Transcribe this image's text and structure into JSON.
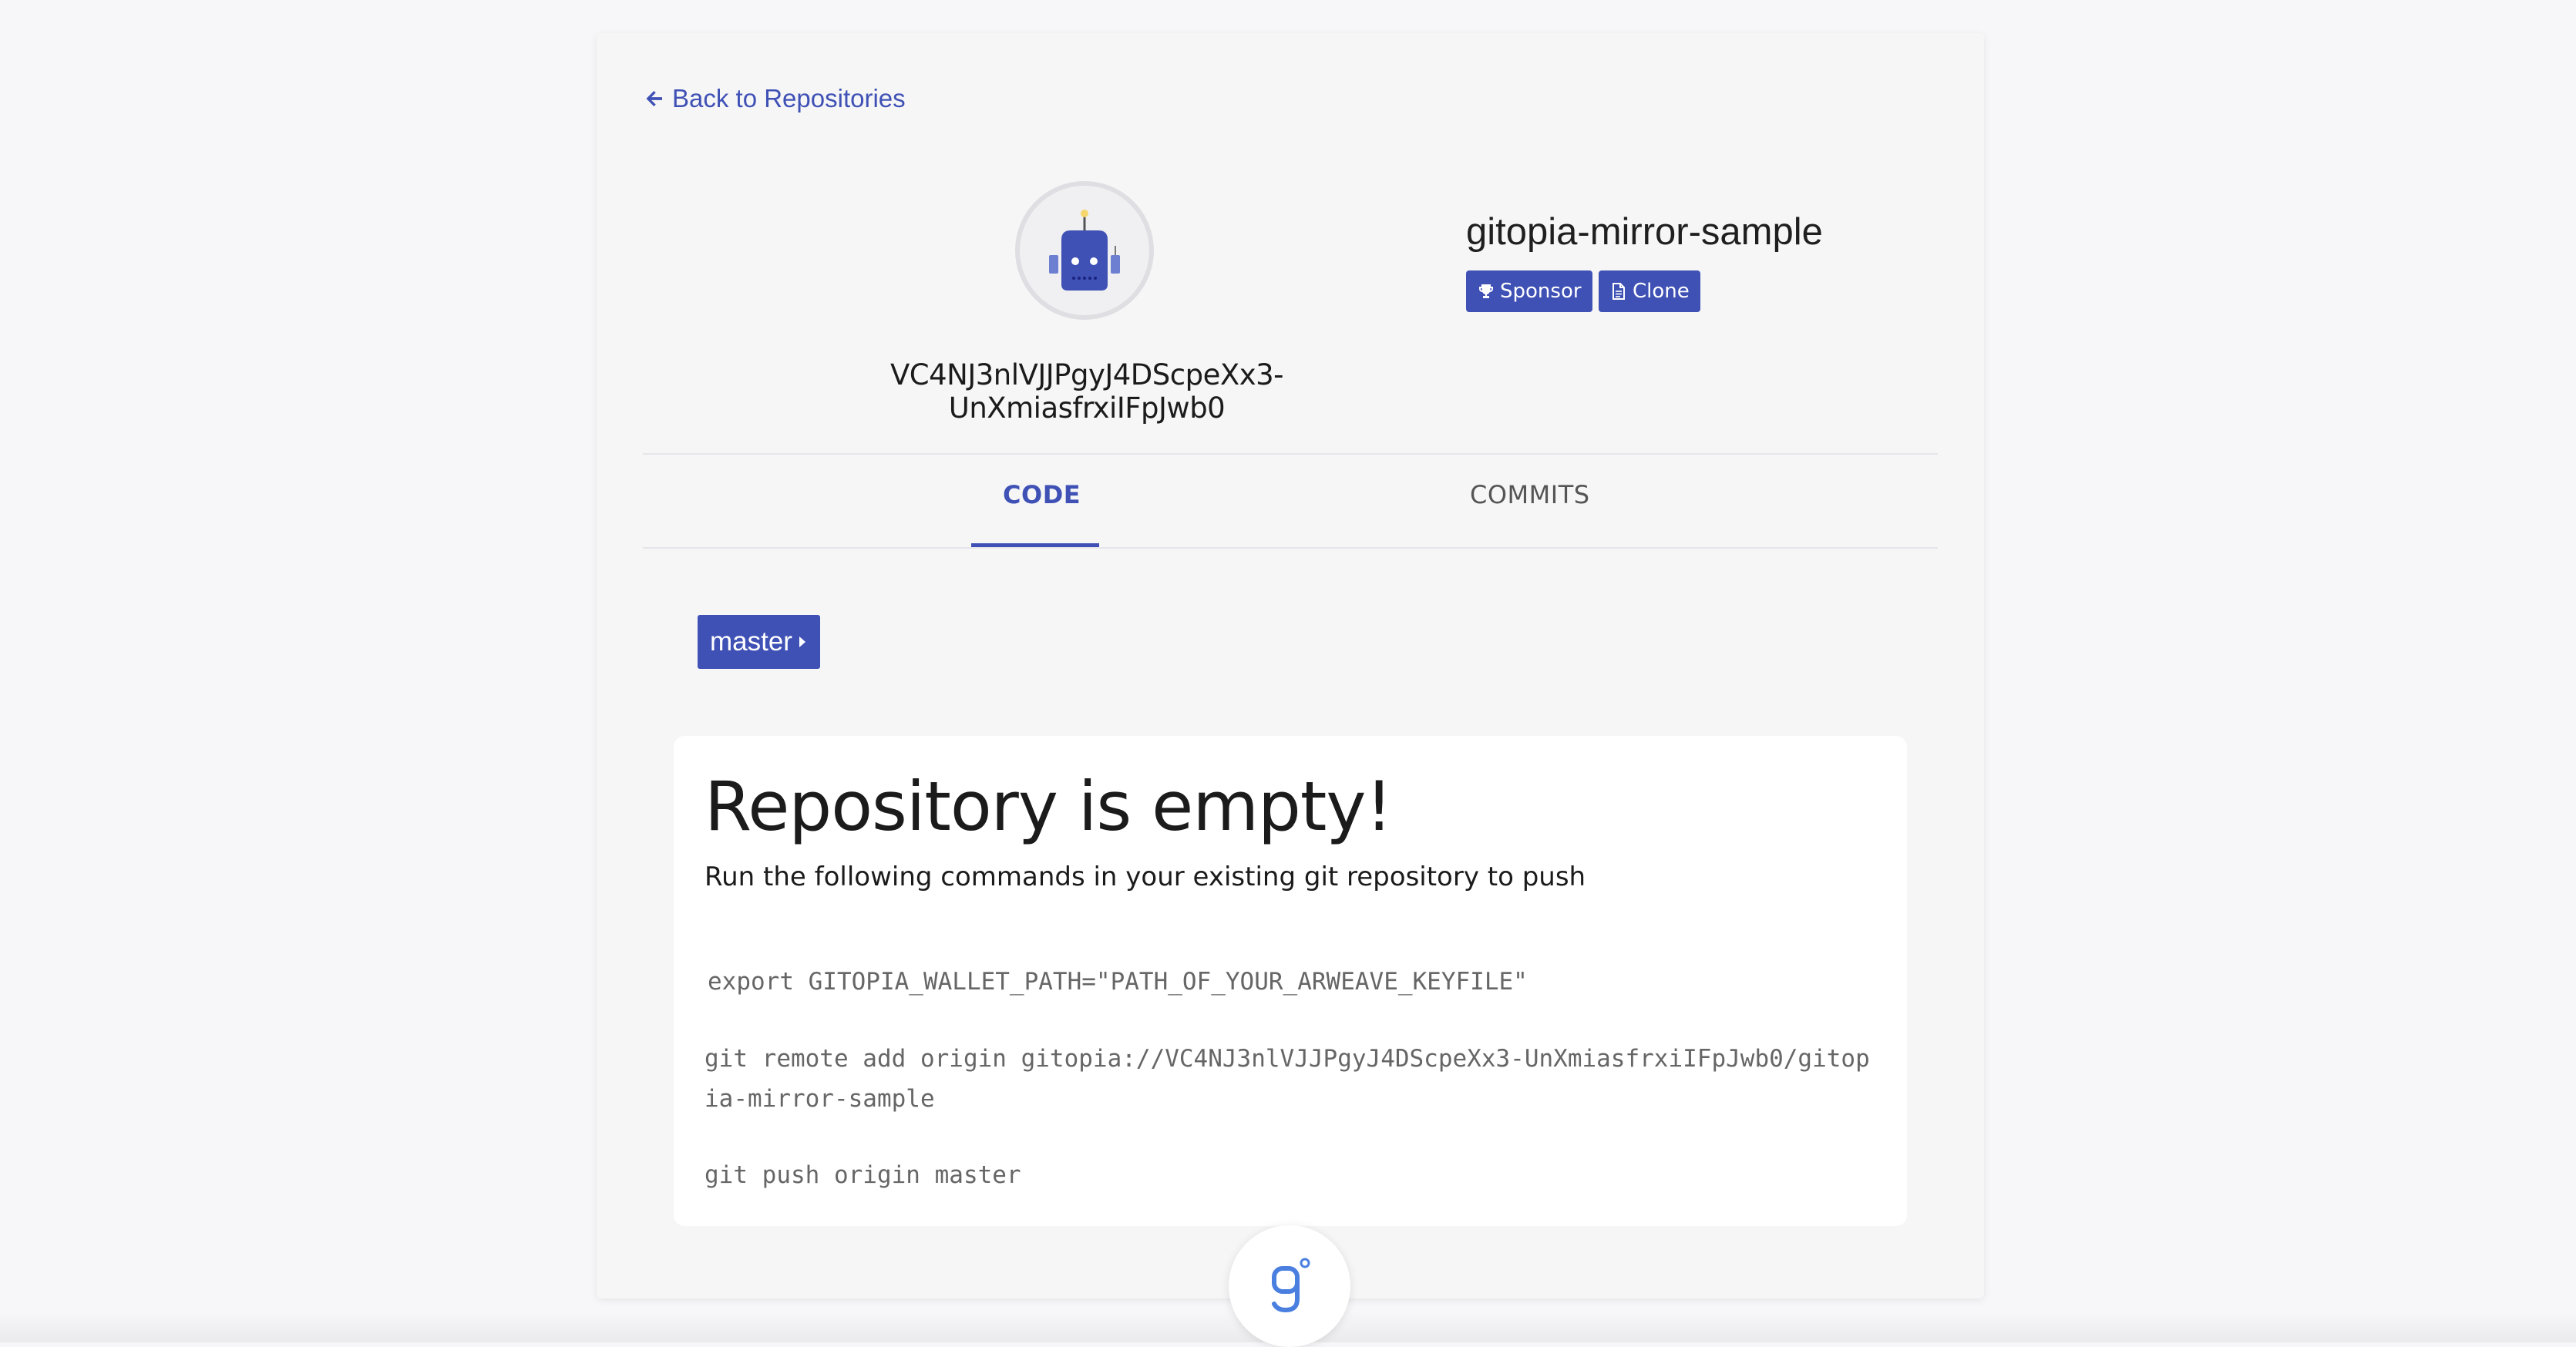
{
  "nav": {
    "back_label": "Back to Repositories"
  },
  "owner": {
    "address": "VC4NJ3nlVJJPgyJ4DScpeXx3-UnXmiasfrxiIFpJwb0"
  },
  "repo": {
    "name": "gitopia-mirror-sample",
    "sponsor_label": "Sponsor",
    "clone_label": "Clone"
  },
  "tabs": [
    {
      "label": "CODE",
      "active": true
    },
    {
      "label": "COMMITS",
      "active": false
    }
  ],
  "branch": {
    "label": "master"
  },
  "empty": {
    "title": "Repository is empty!",
    "subtitle": "Run the following commands in your existing git repository to push",
    "commands": [
      "export GITOPIA_WALLET_PATH=\"PATH_OF_YOUR_ARWEAVE_KEYFILE\"",
      "git remote add origin gitopia://VC4NJ3nlVJJPgyJ4DScpeXx3-UnXmiasfrxiIFpJwb0/gitopia-mirror-sample",
      "git push origin master"
    ]
  },
  "colors": {
    "accent": "#3f51b5",
    "logo": "#4a7fe0"
  }
}
